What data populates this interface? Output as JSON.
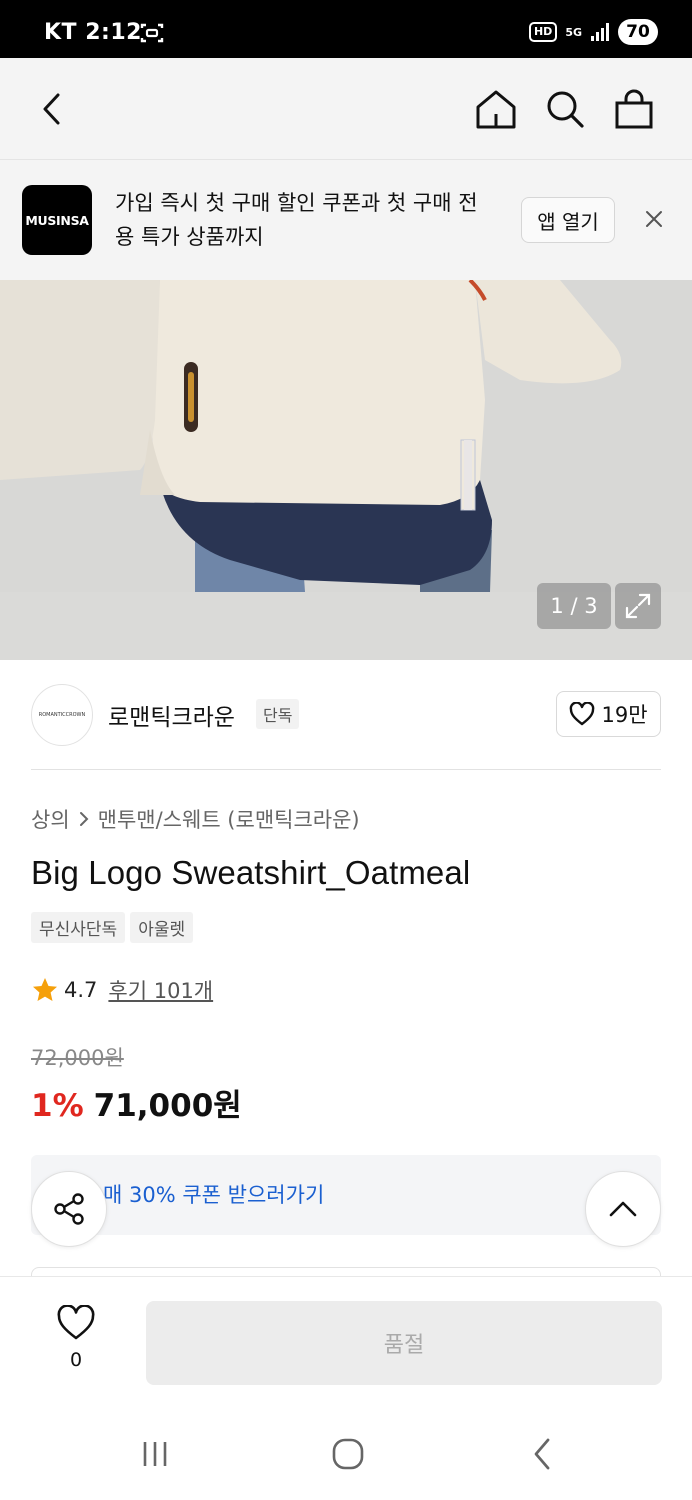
{
  "status_bar": {
    "carrier_time": "KT 2:12",
    "hd_label": "HD",
    "network_label": "5G",
    "battery": "70"
  },
  "header": {
    "icons": [
      "back-icon",
      "home-icon",
      "search-icon",
      "shopping-bag-icon"
    ]
  },
  "banner": {
    "logo_text": "MUSINSA",
    "message": "가입 즉시 첫 구매 할인 쿠폰과 첫 구매 전용 특가 상품까지",
    "open_app_label": "앱 열기"
  },
  "image": {
    "counter": "1 / 3",
    "colors": {
      "background": "#d9d9d7",
      "sweatshirt": "#efe9dd",
      "shirt": "#2a3553",
      "jeans": "#6f86a8"
    }
  },
  "brand": {
    "logo_text": "ROMANTICCROWN",
    "name": "로맨틱크라운",
    "badge": "단독",
    "likes": "19만"
  },
  "product": {
    "breadcrumb": [
      "상의",
      "맨투맨/스웨트 (로맨틱크라운)"
    ],
    "title": "Big Logo Sweatshirt_Oatmeal",
    "tags": [
      "무신사단독",
      "아울렛"
    ],
    "rating": "4.7",
    "reviews": "후기 101개",
    "original_price": "72,000원",
    "discount": "1%",
    "price": "71,000원"
  },
  "coupon": {
    "text": "매 30% 쿠폰 받으러가기"
  },
  "bottom_bar": {
    "wish_count": "0",
    "soldout_label": "품절"
  },
  "colors": {
    "discount_red": "#e0271f",
    "coupon_blue": "#1a5fd0"
  }
}
